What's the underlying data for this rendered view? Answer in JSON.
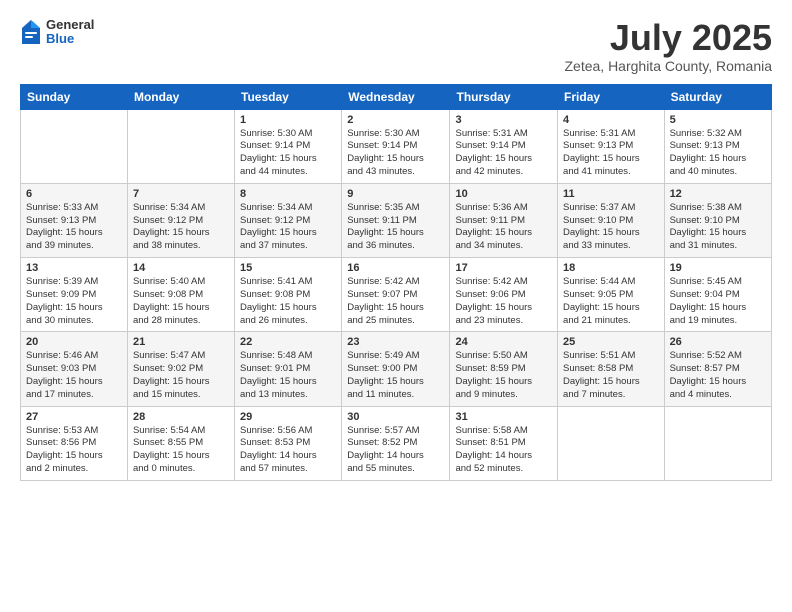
{
  "header": {
    "logo": {
      "general": "General",
      "blue": "Blue"
    },
    "title": "July 2025",
    "location": "Zetea, Harghita County, Romania"
  },
  "weekdays": [
    "Sunday",
    "Monday",
    "Tuesday",
    "Wednesday",
    "Thursday",
    "Friday",
    "Saturday"
  ],
  "weeks": [
    [
      {
        "day": "",
        "info": ""
      },
      {
        "day": "",
        "info": ""
      },
      {
        "day": "1",
        "info": "Sunrise: 5:30 AM\nSunset: 9:14 PM\nDaylight: 15 hours\nand 44 minutes."
      },
      {
        "day": "2",
        "info": "Sunrise: 5:30 AM\nSunset: 9:14 PM\nDaylight: 15 hours\nand 43 minutes."
      },
      {
        "day": "3",
        "info": "Sunrise: 5:31 AM\nSunset: 9:14 PM\nDaylight: 15 hours\nand 42 minutes."
      },
      {
        "day": "4",
        "info": "Sunrise: 5:31 AM\nSunset: 9:13 PM\nDaylight: 15 hours\nand 41 minutes."
      },
      {
        "day": "5",
        "info": "Sunrise: 5:32 AM\nSunset: 9:13 PM\nDaylight: 15 hours\nand 40 minutes."
      }
    ],
    [
      {
        "day": "6",
        "info": "Sunrise: 5:33 AM\nSunset: 9:13 PM\nDaylight: 15 hours\nand 39 minutes."
      },
      {
        "day": "7",
        "info": "Sunrise: 5:34 AM\nSunset: 9:12 PM\nDaylight: 15 hours\nand 38 minutes."
      },
      {
        "day": "8",
        "info": "Sunrise: 5:34 AM\nSunset: 9:12 PM\nDaylight: 15 hours\nand 37 minutes."
      },
      {
        "day": "9",
        "info": "Sunrise: 5:35 AM\nSunset: 9:11 PM\nDaylight: 15 hours\nand 36 minutes."
      },
      {
        "day": "10",
        "info": "Sunrise: 5:36 AM\nSunset: 9:11 PM\nDaylight: 15 hours\nand 34 minutes."
      },
      {
        "day": "11",
        "info": "Sunrise: 5:37 AM\nSunset: 9:10 PM\nDaylight: 15 hours\nand 33 minutes."
      },
      {
        "day": "12",
        "info": "Sunrise: 5:38 AM\nSunset: 9:10 PM\nDaylight: 15 hours\nand 31 minutes."
      }
    ],
    [
      {
        "day": "13",
        "info": "Sunrise: 5:39 AM\nSunset: 9:09 PM\nDaylight: 15 hours\nand 30 minutes."
      },
      {
        "day": "14",
        "info": "Sunrise: 5:40 AM\nSunset: 9:08 PM\nDaylight: 15 hours\nand 28 minutes."
      },
      {
        "day": "15",
        "info": "Sunrise: 5:41 AM\nSunset: 9:08 PM\nDaylight: 15 hours\nand 26 minutes."
      },
      {
        "day": "16",
        "info": "Sunrise: 5:42 AM\nSunset: 9:07 PM\nDaylight: 15 hours\nand 25 minutes."
      },
      {
        "day": "17",
        "info": "Sunrise: 5:42 AM\nSunset: 9:06 PM\nDaylight: 15 hours\nand 23 minutes."
      },
      {
        "day": "18",
        "info": "Sunrise: 5:44 AM\nSunset: 9:05 PM\nDaylight: 15 hours\nand 21 minutes."
      },
      {
        "day": "19",
        "info": "Sunrise: 5:45 AM\nSunset: 9:04 PM\nDaylight: 15 hours\nand 19 minutes."
      }
    ],
    [
      {
        "day": "20",
        "info": "Sunrise: 5:46 AM\nSunset: 9:03 PM\nDaylight: 15 hours\nand 17 minutes."
      },
      {
        "day": "21",
        "info": "Sunrise: 5:47 AM\nSunset: 9:02 PM\nDaylight: 15 hours\nand 15 minutes."
      },
      {
        "day": "22",
        "info": "Sunrise: 5:48 AM\nSunset: 9:01 PM\nDaylight: 15 hours\nand 13 minutes."
      },
      {
        "day": "23",
        "info": "Sunrise: 5:49 AM\nSunset: 9:00 PM\nDaylight: 15 hours\nand 11 minutes."
      },
      {
        "day": "24",
        "info": "Sunrise: 5:50 AM\nSunset: 8:59 PM\nDaylight: 15 hours\nand 9 minutes."
      },
      {
        "day": "25",
        "info": "Sunrise: 5:51 AM\nSunset: 8:58 PM\nDaylight: 15 hours\nand 7 minutes."
      },
      {
        "day": "26",
        "info": "Sunrise: 5:52 AM\nSunset: 8:57 PM\nDaylight: 15 hours\nand 4 minutes."
      }
    ],
    [
      {
        "day": "27",
        "info": "Sunrise: 5:53 AM\nSunset: 8:56 PM\nDaylight: 15 hours\nand 2 minutes."
      },
      {
        "day": "28",
        "info": "Sunrise: 5:54 AM\nSunset: 8:55 PM\nDaylight: 15 hours\nand 0 minutes."
      },
      {
        "day": "29",
        "info": "Sunrise: 5:56 AM\nSunset: 8:53 PM\nDaylight: 14 hours\nand 57 minutes."
      },
      {
        "day": "30",
        "info": "Sunrise: 5:57 AM\nSunset: 8:52 PM\nDaylight: 14 hours\nand 55 minutes."
      },
      {
        "day": "31",
        "info": "Sunrise: 5:58 AM\nSunset: 8:51 PM\nDaylight: 14 hours\nand 52 minutes."
      },
      {
        "day": "",
        "info": ""
      },
      {
        "day": "",
        "info": ""
      }
    ]
  ]
}
